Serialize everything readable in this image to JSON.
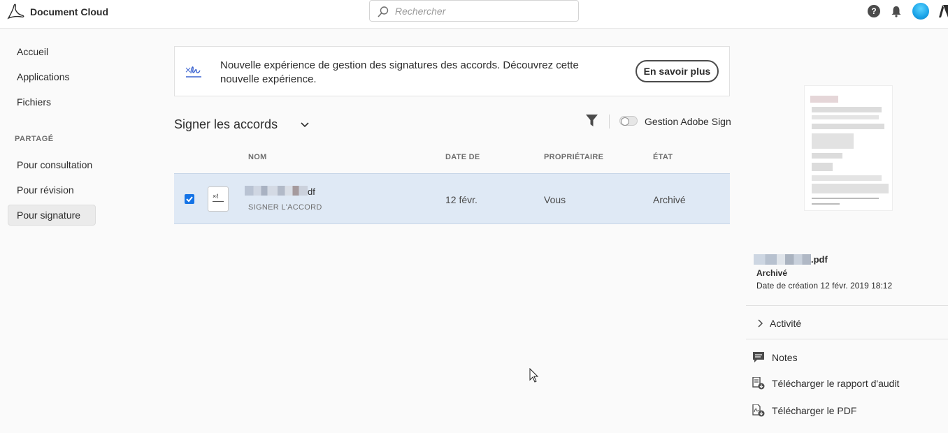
{
  "header": {
    "app_title": "Document Cloud",
    "search_placeholder": "Rechercher",
    "help_glyph": "?"
  },
  "sidebar": {
    "items": [
      {
        "label": "Accueil"
      },
      {
        "label": "Applications"
      },
      {
        "label": "Fichiers"
      }
    ],
    "section_label": "PARTAGÉ",
    "shared_items": [
      {
        "label": "Pour consultation"
      },
      {
        "label": "Pour révision"
      },
      {
        "label": "Pour signature",
        "active": true
      }
    ]
  },
  "banner": {
    "text": "Nouvelle expérience de gestion des signatures des accords. Découvrez cette nouvelle expérience.",
    "button_label": "En savoir plus",
    "icon": "signature-icon"
  },
  "toolbar": {
    "title": "Signer les accords",
    "toggle_label": "Gestion Adobe Sign",
    "toggle_on": false
  },
  "table": {
    "columns": [
      "NOM",
      "DATE DE",
      "PROPRIÉTAIRE",
      "ÉTAT"
    ],
    "rows": [
      {
        "name_suffix": "df",
        "subtitle": "SIGNER L'ACCORD",
        "date": "12 févr.",
        "owner": "Vous",
        "status": "Archivé",
        "selected": true
      }
    ]
  },
  "details": {
    "file_suffix": ".pdf",
    "status": "Archivé",
    "created": "Date de création 12 févr. 2019 18:12",
    "activity_label": "Activité",
    "actions": [
      {
        "label": "Notes",
        "icon": "comment-icon"
      },
      {
        "label": "Télécharger le rapport d'audit",
        "icon": "audit-report-icon"
      },
      {
        "label": "Télécharger le PDF",
        "icon": "download-pdf-icon"
      }
    ]
  },
  "colors": {
    "accent": "#1473e6",
    "selected_row": "#dfe9f5",
    "banner_icon": "#3b63d0"
  }
}
